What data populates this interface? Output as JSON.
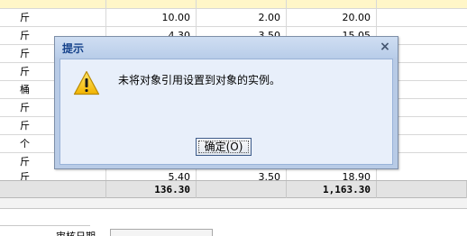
{
  "grid": {
    "rows": [
      {
        "unit": "",
        "a": "",
        "b": "",
        "c": ""
      },
      {
        "unit": "斤",
        "a": "10.00",
        "b": "2.00",
        "c": "20.00"
      },
      {
        "unit": "斤",
        "a": "4.30",
        "b": "3.50",
        "c": "15.05"
      },
      {
        "unit": "斤",
        "a": "",
        "b": "",
        "c": ""
      },
      {
        "unit": "斤",
        "a": "",
        "b": "",
        "c": ""
      },
      {
        "unit": "桶",
        "a": "",
        "b": "",
        "c": ""
      },
      {
        "unit": "斤",
        "a": "",
        "b": "",
        "c": ""
      },
      {
        "unit": "斤",
        "a": "",
        "b": "",
        "c": ""
      },
      {
        "unit": "个",
        "a": "",
        "b": "",
        "c": ""
      },
      {
        "unit": "斤",
        "a": "",
        "b": "",
        "c": ""
      },
      {
        "unit": "斤",
        "a": "5.40",
        "b": "3.50",
        "c": "18.90"
      }
    ],
    "totals": {
      "a": "136.30",
      "b": "",
      "c": "1,163.30"
    }
  },
  "form": {
    "date_label": "审核日期"
  },
  "dialog": {
    "title": "提示",
    "close_glyph": "×",
    "message": "未将对象引用设置到对象的实例。",
    "ok_label": "确定(O)",
    "icon": "warning-icon"
  }
}
